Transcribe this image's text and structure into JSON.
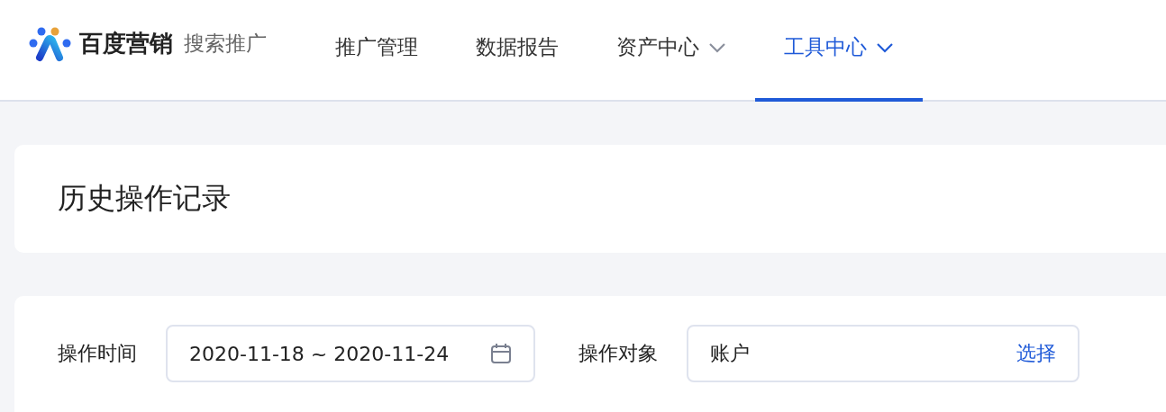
{
  "brand": {
    "name": "百度营销",
    "product": "搜索推广"
  },
  "nav": [
    {
      "label": "推广管理",
      "selected": false,
      "has_dropdown": false
    },
    {
      "label": "数据报告",
      "selected": false,
      "has_dropdown": false
    },
    {
      "label": "资产中心",
      "selected": false,
      "has_dropdown": true
    },
    {
      "label": "工具中心",
      "selected": true,
      "has_dropdown": true
    }
  ],
  "page_title": "历史操作记录",
  "filters": [
    {
      "kind": "date",
      "label": "操作时间",
      "value": "2020-11-18 ~ 2020-11-24"
    },
    {
      "kind": "picker",
      "label": "操作对象",
      "value": "账户",
      "action": "选择"
    }
  ]
}
